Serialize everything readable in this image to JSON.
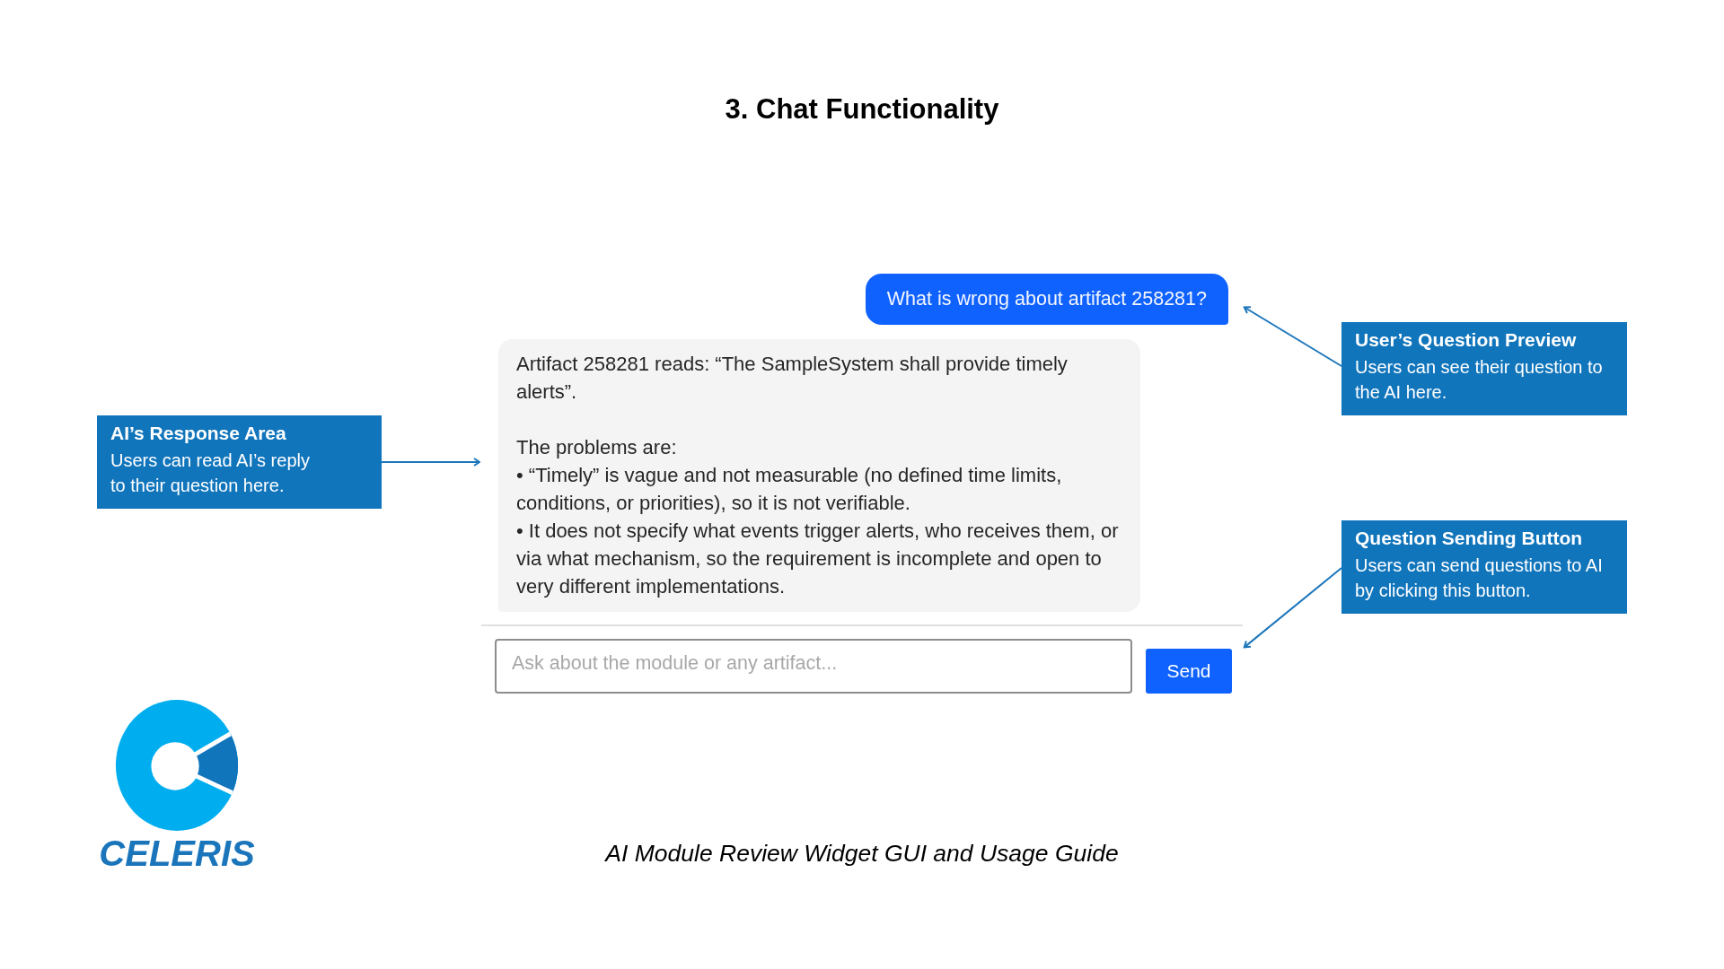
{
  "title": "3. Chat Functionality",
  "chat": {
    "messages": [
      {
        "kind": "user",
        "text": "What is wrong about artifact 258281?"
      },
      {
        "kind": "assistant",
        "blocks": [
          {
            "kind": "paragraph",
            "text": "Artifact 258281 reads: “The SampleSystem shall provide timely alerts”."
          },
          {
            "kind": "paragraph",
            "text": "The problems are:"
          },
          {
            "kind": "bullet",
            "text": "• “Timely” is vague and not measurable (no defined time limits, conditions, or priorities), so it is not verifiable."
          },
          {
            "kind": "bullet",
            "text": "• It does not specify what events trigger alerts, who receives them, or via what mechanism, so the requirement is incomplete and open to very different implementations."
          }
        ]
      }
    ],
    "input": {
      "placeholder": "Ask about the module or any artifact..."
    },
    "send_button": {
      "label": "Send"
    }
  },
  "left_callouts": [
    {
      "title": "AI’s Response Area",
      "text": "Users can read AI’s reply\nto their question here."
    }
  ],
  "right_callouts": [
    {
      "title": "User’s Question Preview",
      "text": "Users can see their question to\nthe AI here."
    },
    {
      "title": "Question Sending Button",
      "text": "Users can send questions to AI\nby clicking this button."
    }
  ],
  "logo": {
    "text": "CELERIS"
  },
  "caption": "AI Module Review Widget GUI and Usage Guide"
}
